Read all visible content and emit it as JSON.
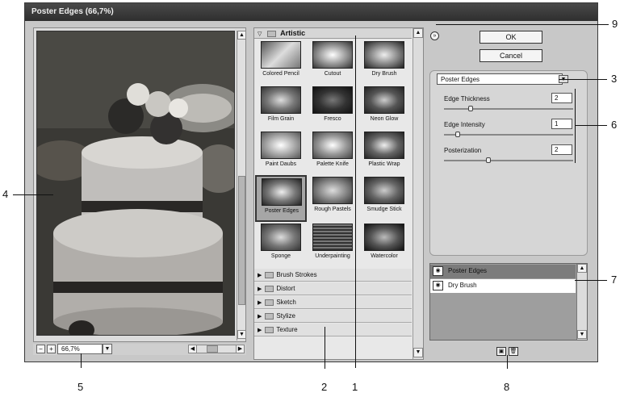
{
  "window": {
    "title": "Poster Edges (66,7%)"
  },
  "preview": {
    "zoom": "66,7%",
    "zoom_minus": "−",
    "zoom_plus": "+"
  },
  "gallery": {
    "open_category": "Artistic",
    "filters": [
      {
        "label": "Colored Pencil"
      },
      {
        "label": "Cutout"
      },
      {
        "label": "Dry Brush"
      },
      {
        "label": "Film Grain"
      },
      {
        "label": "Fresco"
      },
      {
        "label": "Neon Glow"
      },
      {
        "label": "Paint Daubs"
      },
      {
        "label": "Palette Knife"
      },
      {
        "label": "Plastic Wrap"
      },
      {
        "label": "Poster Edges"
      },
      {
        "label": "Rough Pastels"
      },
      {
        "label": "Smudge Stick"
      },
      {
        "label": "Sponge"
      },
      {
        "label": "Underpainting"
      },
      {
        "label": "Watercolor"
      }
    ],
    "selected_filter": "Poster Edges",
    "categories": [
      "Brush Strokes",
      "Distort",
      "Sketch",
      "Stylize",
      "Texture"
    ]
  },
  "buttons": {
    "ok": "OK",
    "cancel": "Cancel",
    "collapse": "»"
  },
  "settings": {
    "filter_select": "Poster Edges",
    "params": [
      {
        "label": "Edge Thickness",
        "value": "2",
        "level": 0.2
      },
      {
        "label": "Edge Intensity",
        "value": "1",
        "level": 0.1
      },
      {
        "label": "Posterization",
        "value": "2",
        "level": 0.33
      }
    ]
  },
  "layers": {
    "items": [
      "Poster Edges",
      "Dry Brush"
    ]
  },
  "callouts": [
    "1",
    "2",
    "3",
    "4",
    "5",
    "6",
    "7",
    "8",
    "9"
  ]
}
